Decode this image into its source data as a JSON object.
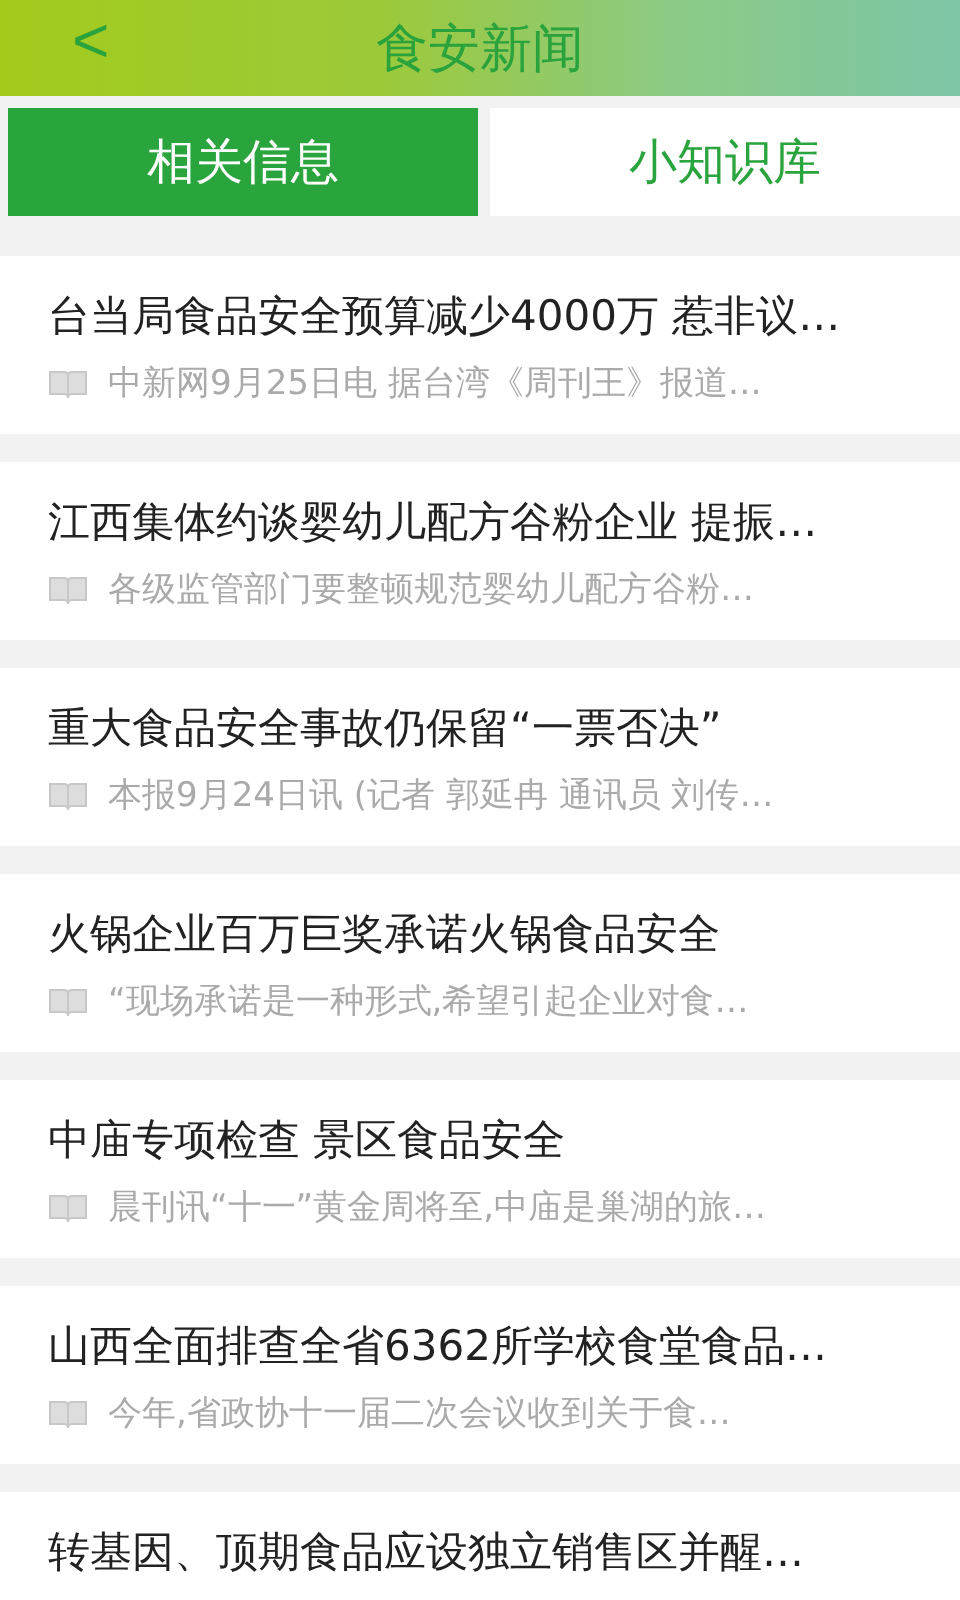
{
  "header": {
    "back": "<",
    "title": "食安新闻"
  },
  "tabs": [
    {
      "label": "相关信息",
      "selected": true
    },
    {
      "label": "小知识库",
      "selected": false
    }
  ],
  "news": [
    {
      "title": "台当局食品安全预算减少4000万 惹非议…",
      "summary": "中新网9月25日电 据台湾《周刊王》报道…"
    },
    {
      "title": "江西集体约谈婴幼儿配方谷粉企业 提振…",
      "summary": "各级监管部门要整顿规范婴幼儿配方谷粉…"
    },
    {
      "title": "重大食品安全事故仍保留“一票否决”",
      "summary": "本报9月24日讯 (记者 郭延冉 通讯员 刘传…"
    },
    {
      "title": "火锅企业百万巨奖承诺火锅食品安全",
      "summary": "“现场承诺是一种形式,希望引起企业对食…"
    },
    {
      "title": "中庙专项检查 景区食品安全",
      "summary": "晨刊讯“十一”黄金周将至,中庙是巢湖的旅…"
    },
    {
      "title": "山西全面排查全省6362所学校食堂食品…",
      "summary": "今年,省政协十一届二次会议收到关于食…"
    },
    {
      "title": "转基因、顶期食品应设独立销售区并醒…"
    }
  ]
}
